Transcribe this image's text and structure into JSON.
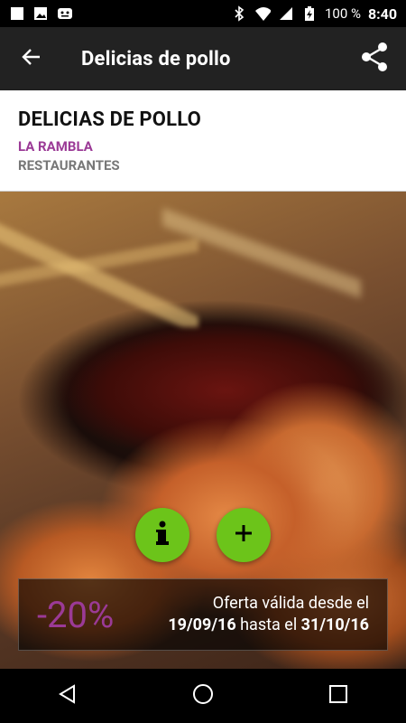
{
  "status_bar": {
    "battery_percent": "100 %",
    "time": "8:40",
    "icons": [
      "notification-square-icon",
      "image-icon",
      "android-icon",
      "bluetooth-icon",
      "wifi-icon",
      "signal-icon",
      "battery-charging-icon"
    ]
  },
  "app_bar": {
    "title": "Delicias de pollo",
    "back_icon": "arrow-left-icon",
    "share_icon": "share-icon"
  },
  "header": {
    "name": "DELICIAS DE POLLO",
    "place": "LA RAMBLA",
    "category": "RESTAURANTES"
  },
  "hero": {
    "info_button_icon": "info-icon",
    "add_button_icon": "plus-icon"
  },
  "offer": {
    "discount": "-20%",
    "line1": "Oferta válida desde el",
    "from_date": "19/09/16",
    "between": " hasta el ",
    "to_date": "31/10/16"
  },
  "nav": {
    "back_icon": "triangle-back-icon",
    "home_icon": "circle-home-icon",
    "recents_icon": "square-recents-icon"
  },
  "colors": {
    "accent_purple": "#9b3a96",
    "fab_green": "#6cc41a",
    "app_bar": "#222222"
  }
}
